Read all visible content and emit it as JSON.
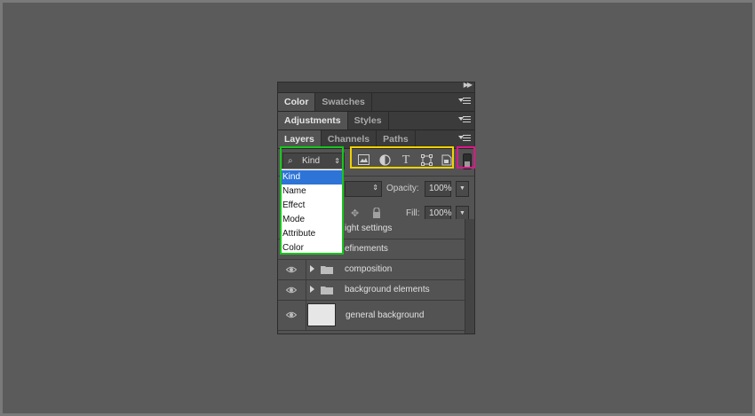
{
  "panels": {
    "color_group": {
      "tabs": [
        "Color",
        "Swatches"
      ],
      "active": 0
    },
    "adjustments_group": {
      "tabs": [
        "Adjustments",
        "Styles"
      ],
      "active": 0
    },
    "layers_group": {
      "tabs": [
        "Layers",
        "Channels",
        "Paths"
      ],
      "active": 0
    }
  },
  "filter": {
    "kind_value": "Kind",
    "options": [
      "Kind",
      "Name",
      "Effect",
      "Mode",
      "Attribute",
      "Color"
    ],
    "selected_index": 0,
    "icons": [
      "image-filter-icon",
      "adjustment-filter-icon",
      "type-filter-icon",
      "shape-filter-icon",
      "smart-object-filter-icon"
    ]
  },
  "opacity": {
    "label": "Opacity:",
    "value": "100%"
  },
  "fill": {
    "label": "Fill:",
    "value": "100%"
  },
  "layers": [
    {
      "name": "ight settings",
      "type": "folder"
    },
    {
      "name": "efinements",
      "type": "folder"
    },
    {
      "name": "composition",
      "type": "folder"
    },
    {
      "name": "background elements",
      "type": "folder"
    },
    {
      "name": "general background",
      "type": "pixel"
    }
  ],
  "highlight_colors": {
    "green": "#18c61b",
    "yellow": "#f1d100",
    "pink": "#e0158a"
  }
}
